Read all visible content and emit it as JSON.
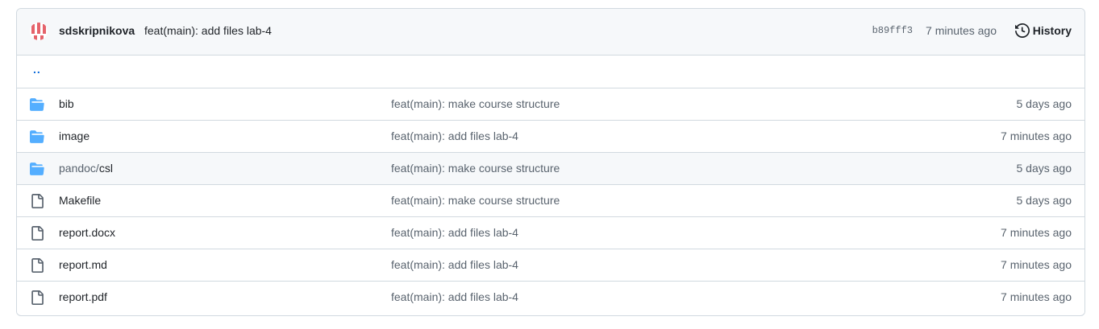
{
  "commit": {
    "author": "sdskripnikova",
    "message": "feat(main): add files lab-4",
    "sha": "b89fff3",
    "time": "7 minutes ago",
    "history_label": "History"
  },
  "parent_link": "..",
  "colors": {
    "folder": "#54aeff",
    "link": "#0969da",
    "avatar_stripe": "#e5636b"
  },
  "files": [
    {
      "name_prefix": "",
      "name": "bib",
      "type": "folder",
      "message": "feat(main): make course structure",
      "time": "5 days ago"
    },
    {
      "name_prefix": "",
      "name": "image",
      "type": "folder",
      "message": "feat(main): add files lab-4",
      "time": "7 minutes ago"
    },
    {
      "name_prefix": "pandoc/",
      "name": "csl",
      "type": "folder",
      "message": "feat(main): make course structure",
      "time": "5 days ago"
    },
    {
      "name_prefix": "",
      "name": "Makefile",
      "type": "file",
      "message": "feat(main): make course structure",
      "time": "5 days ago"
    },
    {
      "name_prefix": "",
      "name": "report.docx",
      "type": "file",
      "message": "feat(main): add files lab-4",
      "time": "7 minutes ago"
    },
    {
      "name_prefix": "",
      "name": "report.md",
      "type": "file",
      "message": "feat(main): add files lab-4",
      "time": "7 minutes ago"
    },
    {
      "name_prefix": "",
      "name": "report.pdf",
      "type": "file",
      "message": "feat(main): add files lab-4",
      "time": "7 minutes ago"
    }
  ]
}
